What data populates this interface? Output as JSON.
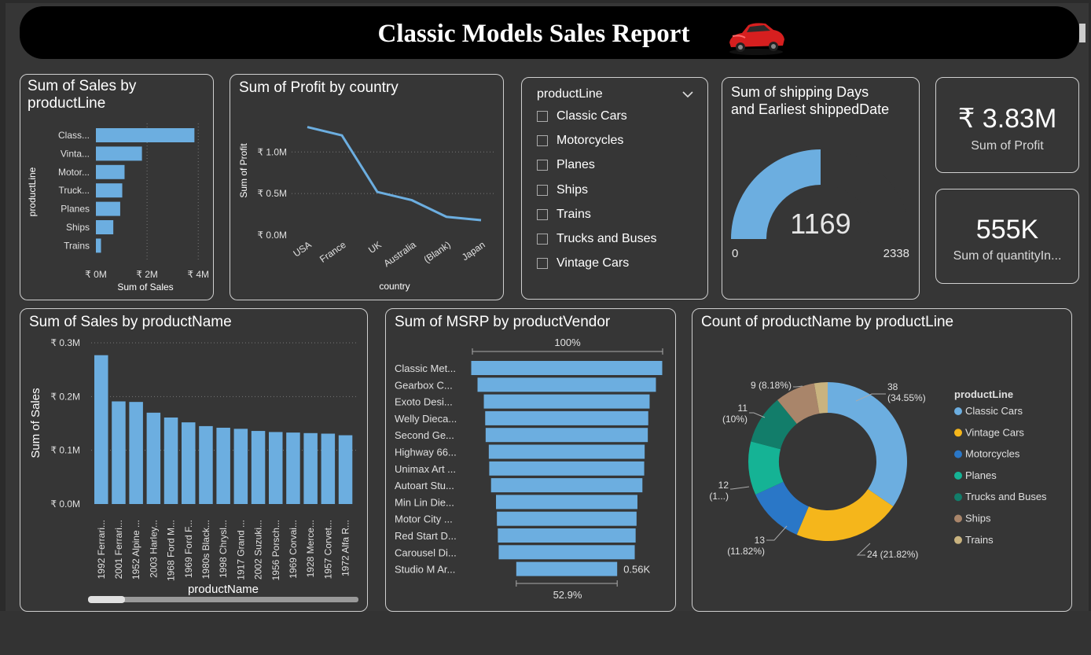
{
  "title": "Classic Models Sales Report",
  "colors": {
    "bar": "#6caee0",
    "background": "#363636",
    "border": "#cfcfcf"
  },
  "slicer": {
    "label": "productLine",
    "items": [
      "Classic Cars",
      "Motorcycles",
      "Planes",
      "Ships",
      "Trains",
      "Trucks and Buses",
      "Vintage Cars"
    ]
  },
  "gauge": {
    "title_line1": "Sum of shipping Days",
    "title_line2": "and Earliest shippedDate",
    "value_label": "1169",
    "min_label": "0",
    "max_label": "2338"
  },
  "kpis": [
    {
      "value": "₹ 3.83M",
      "label": "Sum of Profit"
    },
    {
      "value": "555K",
      "label": "Sum of quantityIn..."
    }
  ],
  "chart_data": [
    {
      "type": "bar",
      "orientation": "horizontal",
      "title": "Sum of Sales by productLine",
      "title_lines": [
        "Sum of Sales by",
        "productLine"
      ],
      "categories": [
        "Class...",
        "Vinta...",
        "Motor...",
        "Truck...",
        "Planes",
        "Ships",
        "Trains"
      ],
      "values": [
        3.85,
        1.8,
        1.12,
        1.03,
        0.95,
        0.68,
        0.2
      ],
      "xlabel": "Sum of Sales",
      "ylabel": "productLine",
      "xlim": [
        0,
        4.3
      ],
      "xticks": [
        "₹ 0M",
        "₹ 2M",
        "₹ 4M"
      ],
      "unit": "M"
    },
    {
      "type": "line",
      "title": "Sum of Profit by country",
      "categories": [
        "USA",
        "France",
        "UK",
        "Australia",
        "(Blank)",
        "Japan"
      ],
      "values": [
        1.3,
        1.2,
        0.52,
        0.42,
        0.22,
        0.18
      ],
      "xlabel": "country",
      "ylabel": "Sum of Profit",
      "ylim": [
        0,
        1.4
      ],
      "yticks": [
        "₹ 0.0M",
        "₹ 0.5M",
        "₹ 1.0M"
      ],
      "unit": "M"
    },
    {
      "type": "bar",
      "title": "Sum of Sales by productName",
      "categories": [
        "1992 Ferrari...",
        "2001 Ferrari...",
        "1952 Alpine ...",
        "2003 Harley...",
        "1968 Ford M...",
        "1969 Ford F...",
        "1980s Black...",
        "1998 Chrysl...",
        "1917 Grand ...",
        "2002 Suzuki...",
        "1956 Porsch...",
        "1969 Corvai...",
        "1928 Merce...",
        "1957 Corvet...",
        "1972 Alfa R..."
      ],
      "values": [
        0.277,
        0.191,
        0.19,
        0.17,
        0.161,
        0.152,
        0.145,
        0.142,
        0.14,
        0.136,
        0.134,
        0.133,
        0.132,
        0.131,
        0.128
      ],
      "xlabel": "productName",
      "ylabel": "Sum of Sales",
      "ylim": [
        0,
        0.3
      ],
      "yticks": [
        "₹ 0.0M",
        "₹ 0.1M",
        "₹ 0.2M",
        "₹ 0.3M"
      ],
      "unit": "M"
    },
    {
      "type": "bar",
      "subtype": "funnel",
      "title": "Sum of MSRP by productVendor",
      "categories": [
        "Classic Met...",
        "Gearbox C...",
        "Exoto Desi...",
        "Welly Dieca...",
        "Second Ge...",
        "Highway 66...",
        "Unimax Art ...",
        "Autoart Stu...",
        "Min Lin Die...",
        "Motor City ...",
        "Red Start D...",
        "Carousel Di...",
        "Studio M Ar..."
      ],
      "values": [
        1.06,
        0.99,
        0.92,
        0.905,
        0.9,
        0.865,
        0.86,
        0.84,
        0.785,
        0.775,
        0.765,
        0.755,
        0.56
      ],
      "unit": "K",
      "top_label": "100%",
      "bottom_label": "52.9%",
      "last_value_label": "0.56K"
    },
    {
      "type": "pie",
      "subtype": "donut",
      "title": "Count of productName by productLine",
      "legend_title": "productLine",
      "legend_position": "right",
      "slices": [
        {
          "name": "Classic Cars",
          "value": 38,
          "label": "38 (34.55%)",
          "color": "#6caee0"
        },
        {
          "name": "Vintage Cars",
          "value": 24,
          "label": "24 (21.82%)",
          "color": "#f5b61b"
        },
        {
          "name": "Motorcycles",
          "value": 13,
          "label": "13 (11.82%)",
          "color": "#2a77c7"
        },
        {
          "name": "Planes",
          "value": 12,
          "label": "12 (1...)",
          "color": "#15b395"
        },
        {
          "name": "Trucks and Buses",
          "value": 11,
          "label": "11 (10%)",
          "color": "#127d6a"
        },
        {
          "name": "Ships",
          "value": 9,
          "label": "9 (8.18%)",
          "color": "#a9856a"
        },
        {
          "name": "Trains",
          "value": 3,
          "label": "",
          "color": "#c9b37f"
        }
      ]
    }
  ]
}
